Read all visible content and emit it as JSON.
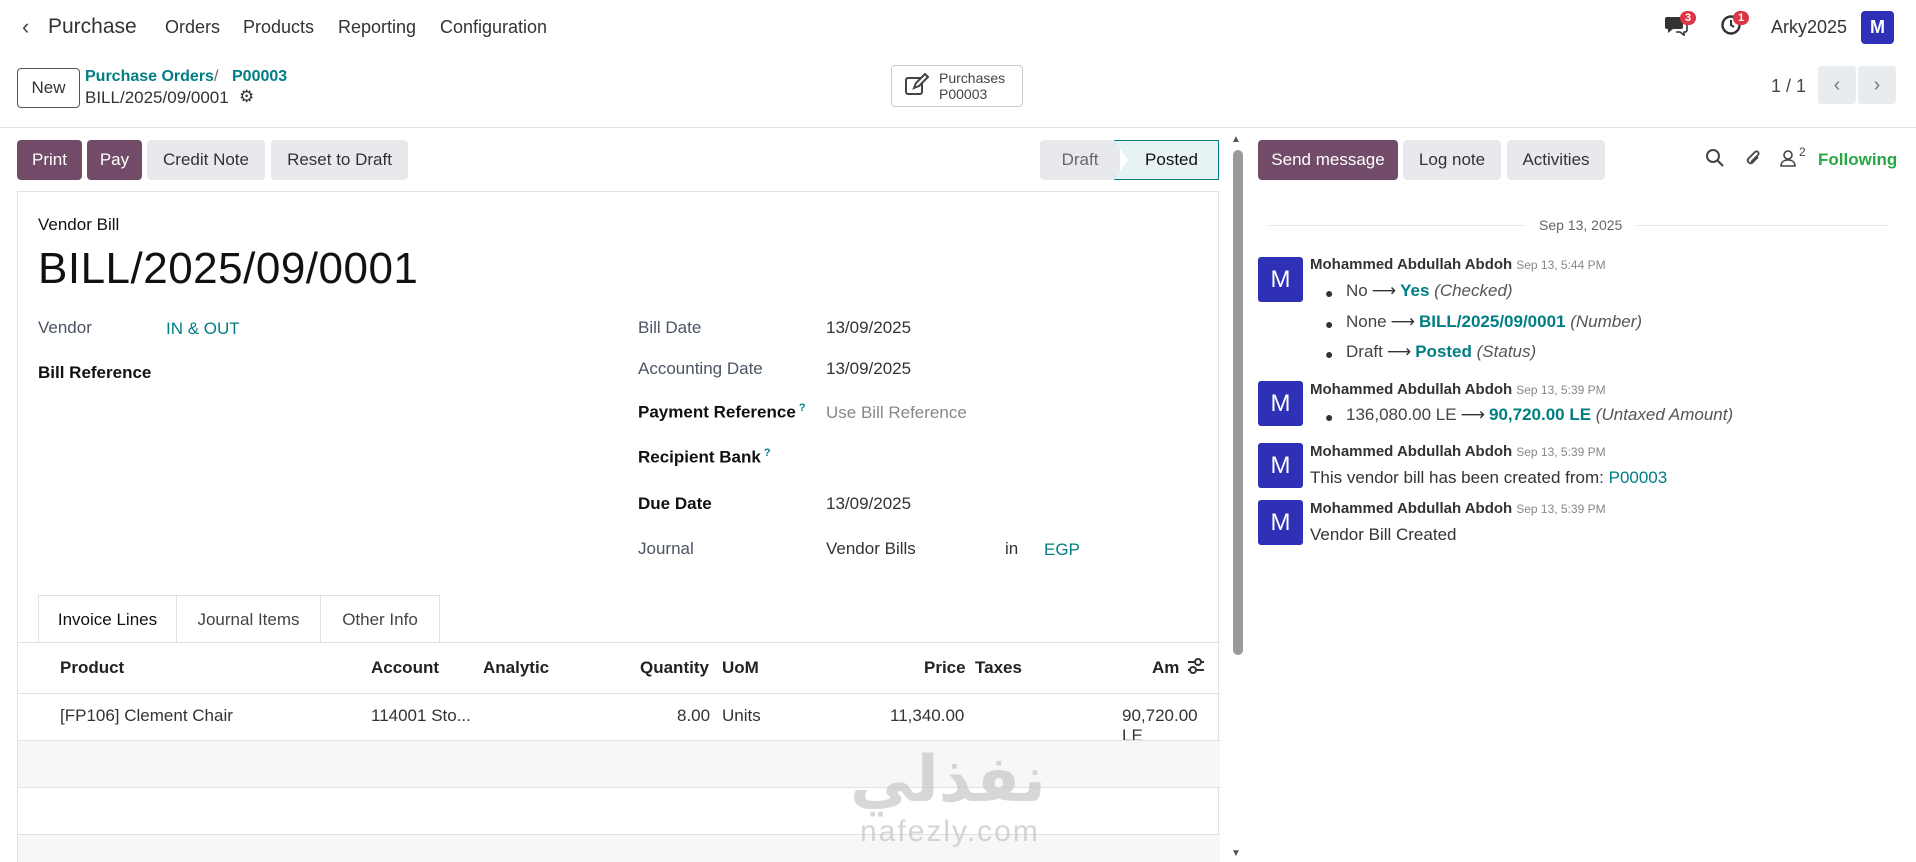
{
  "nav": {
    "app_name": "Purchase",
    "menus": [
      "Orders",
      "Products",
      "Reporting",
      "Configuration"
    ],
    "messages_count": "3",
    "activities_count": "1",
    "username": "Arky2025",
    "avatar_letter": "M"
  },
  "control": {
    "new_label": "New",
    "breadcrumb": [
      "Purchase Orders",
      "P00003"
    ],
    "breadcrumb_sep": "/",
    "current_record": "BILL/2025/09/0001",
    "smart_button": {
      "title": "Purchases",
      "value": "P00003"
    },
    "pager": "1 / 1"
  },
  "actions": {
    "print": "Print",
    "pay": "Pay",
    "credit_note": "Credit Note",
    "reset_to_draft": "Reset to Draft"
  },
  "statusbar": {
    "draft": "Draft",
    "posted": "Posted",
    "active": "Posted"
  },
  "form": {
    "type_label": "Vendor Bill",
    "title": "BILL/2025/09/0001",
    "vendor_label": "Vendor",
    "vendor_value": "IN & OUT",
    "bill_reference_label": "Bill Reference",
    "bill_date_label": "Bill Date",
    "bill_date_value": "13/09/2025",
    "accounting_date_label": "Accounting Date",
    "accounting_date_value": "13/09/2025",
    "payment_reference_label": "Payment Reference",
    "payment_reference_placeholder": "Use Bill Reference",
    "recipient_bank_label": "Recipient Bank",
    "due_date_label": "Due Date",
    "due_date_value": "13/09/2025",
    "journal_label": "Journal",
    "journal_value": "Vendor Bills",
    "journal_in": "in",
    "currency": "EGP",
    "help_mark": "?"
  },
  "tabs": [
    "Invoice Lines",
    "Journal Items",
    "Other Info"
  ],
  "table": {
    "headers": {
      "product": "Product",
      "account": "Account",
      "analytic": "Analytic",
      "quantity": "Quantity",
      "uom": "UoM",
      "price": "Price",
      "taxes": "Taxes",
      "amount": "Am"
    },
    "rows": [
      {
        "product": "[FP106] Clement Chair",
        "account": "114001 Sto...",
        "quantity": "8.00",
        "uom": "Units",
        "price": "11,340.00",
        "amount": "90,720.00 LE"
      }
    ]
  },
  "chatter": {
    "send_message": "Send message",
    "log_note": "Log note",
    "activities": "Activities",
    "followers_count": "2",
    "following": "Following",
    "date_separator": "Sep 13, 2025",
    "messages": [
      {
        "avatar": "M",
        "author": "Mohammed Abdullah Abdoh",
        "date": "Sep 13, 5:44 PM",
        "changes": [
          {
            "old": "No",
            "new": "Yes",
            "field": "(Checked)"
          },
          {
            "old": "None",
            "new": "BILL/2025/09/0001",
            "field": "(Number)"
          },
          {
            "old": "Draft",
            "new": "Posted",
            "field": "(Status)"
          }
        ]
      },
      {
        "avatar": "M",
        "author": "Mohammed Abdullah Abdoh",
        "date": "Sep 13, 5:39 PM",
        "changes": [
          {
            "old": "136,080.00 LE",
            "new": "90,720.00 LE",
            "field": "(Untaxed Amount)"
          }
        ]
      },
      {
        "avatar": "M",
        "author": "Mohammed Abdullah Abdoh",
        "date": "Sep 13, 5:39 PM",
        "body": "This vendor bill has been created from:",
        "body_link": "P00003"
      },
      {
        "avatar": "M",
        "author": "Mohammed Abdullah Abdoh",
        "date": "Sep 13, 5:39 PM",
        "body": "Vendor Bill Created"
      }
    ]
  },
  "watermark": {
    "arabic": "نفذلي",
    "latin": "nafezly.com"
  },
  "colors": {
    "primary": "#714b67",
    "link": "#017e84",
    "avatar": "#2e31b5",
    "badge": "#dc3545",
    "following": "#28a745"
  }
}
